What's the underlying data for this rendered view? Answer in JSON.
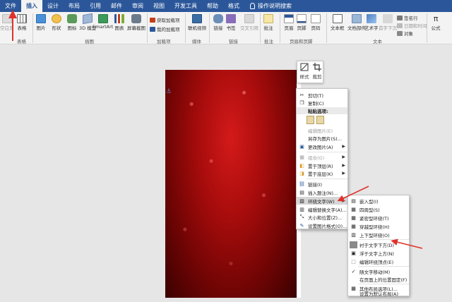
{
  "ribbon_tabs": {
    "file": "文件",
    "insert": "插入",
    "design": "设计",
    "layout": "布局",
    "references": "引用",
    "mailings": "邮件",
    "review": "审阅",
    "view": "视图",
    "developer": "开发工具",
    "help": "帮助",
    "format": "格式",
    "search": "操作说明搜索"
  },
  "ribbon": {
    "blank_page": "空白页",
    "table": "表格",
    "picture": "图片",
    "shapes": "形状",
    "icons": "图标",
    "model3d": "3D 模型",
    "smartart": "SmartArt",
    "chart": "图表",
    "screenshot": "屏幕截图",
    "get_addins": "获取加载项",
    "my_addins": "我的加载项",
    "online_video": "联机视频",
    "link": "链接",
    "bookmark": "书签",
    "cross_ref": "交叉引用",
    "comment": "批注",
    "header": "页眉",
    "footer": "页脚",
    "page_number": "页码",
    "text_box": "文本框",
    "quick_parts": "文档部件",
    "wordart": "艺术字",
    "drop_cap": "首字下沉",
    "signature_line": "签名行",
    "date_time": "日期和时间",
    "object": "对象",
    "equation": "公式",
    "groups": {
      "tables": "表格",
      "illustrations": "插图",
      "addins": "加载项",
      "media": "媒体",
      "links": "链接",
      "comments": "批注",
      "header_footer": "页眉和页脚",
      "text": "文本"
    }
  },
  "mini_toolbar": {
    "style": "样式",
    "crop": "裁剪"
  },
  "context_menu": {
    "cut": "剪切(T)",
    "copy": "复制(C)",
    "paste_options": "粘贴选项:",
    "edit_picture": "编辑图片(E)",
    "save_as_picture": "另存为图片(S)...",
    "change_picture": "更改图片(A)",
    "group": "组合(G)",
    "bring_to_front": "置于顶层(R)",
    "send_to_back": "置于底层(K)",
    "link": "链接(I)",
    "insert_caption": "插入题注(N)...",
    "wrap_text": "环绕文字(W)",
    "edit_alt_text": "编辑替换文字(A)...",
    "size_position": "大小和位置(Z)...",
    "format_picture": "设置图片格式(O)..."
  },
  "wrap_submenu": {
    "inline": "嵌入型(I)",
    "square": "四周型(S)",
    "tight": "紧密型环绕(T)",
    "through": "穿越型环绕(H)",
    "top_bottom": "上下型环绕(O)",
    "behind_text": "衬于文字下方(D)",
    "in_front": "浮于文字上方(N)",
    "edit_wrap_points": "编辑环绕顶点(E)",
    "move_with_text": "随文字移动(M)",
    "fix_position": "在页面上的位置固定(F)",
    "more_layout": "其他布局选项(L)...",
    "set_default": "设置为默认布局(A)"
  },
  "colors": {
    "ribbon_blue": "#2b579a",
    "annotation_red": "#e0312b",
    "photo_red": "#b01010"
  }
}
